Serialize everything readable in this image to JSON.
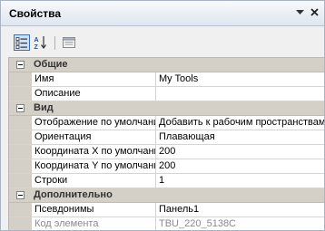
{
  "panel": {
    "title": "Свойства"
  },
  "toolbar": {
    "categorized": "categorized-view-icon",
    "alphabetical": "alphabetical-sort-icon",
    "property_pages": "property-pages-icon"
  },
  "categories": [
    {
      "label": "Общие",
      "rows": [
        {
          "name": "Имя",
          "value": "My Tools"
        },
        {
          "name": "Описание",
          "value": ""
        }
      ]
    },
    {
      "label": "Вид",
      "rows": [
        {
          "name": "Отображение по умолчанию",
          "value": "Добавить к рабочим пространствам"
        },
        {
          "name": "Ориентация",
          "value": "Плавающая"
        },
        {
          "name": "Координата X по умолчанию",
          "value": "200"
        },
        {
          "name": "Координата Y по умолчанию",
          "value": "200"
        },
        {
          "name": "Строки",
          "value": "1"
        }
      ]
    },
    {
      "label": "Дополнительно",
      "rows": [
        {
          "name": "Псевдонимы",
          "value": "Панель1"
        },
        {
          "name": "Код элемента",
          "value": "TBU_220_5138C",
          "readonly": true
        }
      ]
    }
  ]
}
